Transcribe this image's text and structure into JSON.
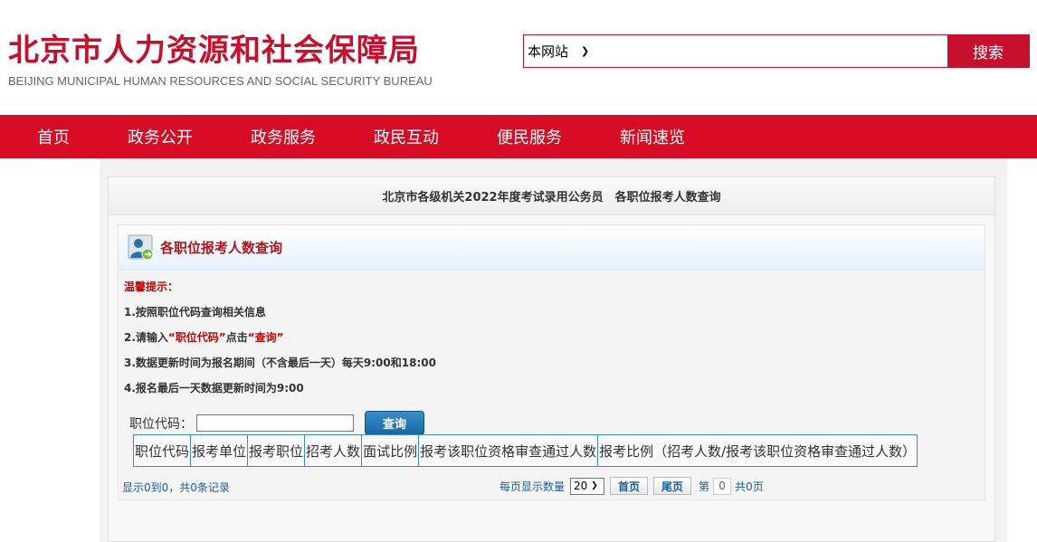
{
  "header": {
    "logo_cn": "北京市人力资源和社会保障局",
    "logo_en": "BEIJING MUNICIPAL HUMAN RESOURCES AND SOCIAL SECURITY BUREAU"
  },
  "search": {
    "scope_selected": "本网站",
    "button_label": "搜索",
    "placeholder": ""
  },
  "nav": {
    "items": [
      {
        "label": "首页"
      },
      {
        "label": "政务公开"
      },
      {
        "label": "政务服务"
      },
      {
        "label": "政民互动"
      },
      {
        "label": "便民服务"
      },
      {
        "label": "新闻速览"
      }
    ]
  },
  "card": {
    "title": "北京市各级机关2022年度考试录用公务员　各职位报考人数查询"
  },
  "panel": {
    "title": "各职位报考人数查询",
    "tips_heading": "温馨提示：",
    "tip1": "1.按照职位代码查询相关信息",
    "tip2_prefix": "2.请输入",
    "tip2_code": "“职位代码”",
    "tip2_mid": "点击",
    "tip2_query": "“查询”",
    "tip3": "3.数据更新时间为报名期间（不含最后一天）每天9:00和18:00",
    "tip4": "4.报名最后一天数据更新时间为9:00"
  },
  "query": {
    "label": "职位代码：",
    "input_value": "",
    "button_label": "查询"
  },
  "table": {
    "columns": [
      "职位代码",
      "报考单位",
      "报考职位",
      "招考人数",
      "面试比例",
      "报考该职位资格审查通过人数",
      "报考比例（招考人数/报考该职位资格审查通过人数）"
    ]
  },
  "pager": {
    "summary": "显示0到0，共0条记录",
    "page_size_label": "每页显示数量",
    "page_size": "20",
    "first_label": "首页",
    "last_label": "尾页",
    "page_prefix": "第",
    "current_page": "0",
    "total_pages": "共0页"
  },
  "colors": {
    "brand_red": "#d70c24",
    "accent_blue": "#1866a3"
  }
}
